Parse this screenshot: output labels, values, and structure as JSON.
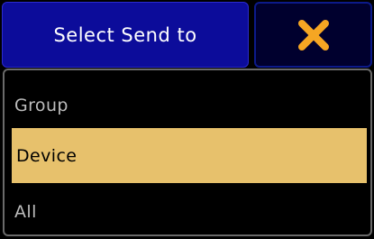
{
  "dialog": {
    "title": "Select Send to"
  },
  "close_button": {
    "icon": "close-icon",
    "color": "#f5a623"
  },
  "options": [
    {
      "label": "Group",
      "selected": false
    },
    {
      "label": "Device",
      "selected": true
    },
    {
      "label": "All",
      "selected": false
    }
  ],
  "colors": {
    "title_bg": "#0c0c9a",
    "selected_bg": "#e7c16c",
    "item_text": "#bcbcbc"
  }
}
